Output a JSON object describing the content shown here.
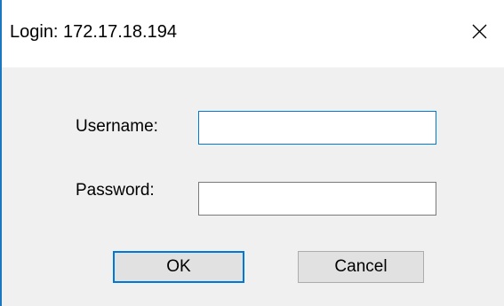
{
  "window": {
    "title": "Login: 172.17.18.194",
    "close_icon": "close-icon"
  },
  "form": {
    "username_label": "Username:",
    "username_value": "",
    "password_label": "Password:",
    "password_value": ""
  },
  "buttons": {
    "ok_label": "OK",
    "cancel_label": "Cancel"
  },
  "colors": {
    "accent": "#0078d7",
    "window_border": "#1a78c2",
    "dialog_background": "#f0f0f0"
  }
}
